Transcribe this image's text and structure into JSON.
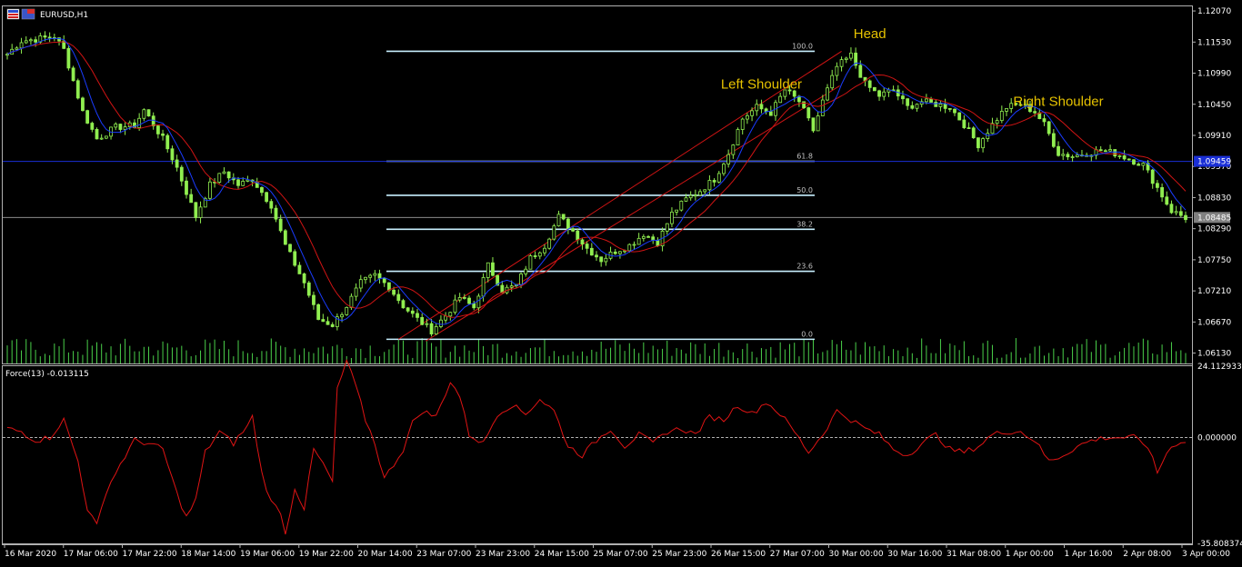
{
  "window": {
    "symbol_label": "EURUSD,H1",
    "flag_icon": "eurusd-flag-icon"
  },
  "indicator": {
    "title": "Force(13) -0.013115"
  },
  "colors": {
    "background": "#000000",
    "bull": "#90ee50",
    "ma_fast": "#1a3cff",
    "ma_slow": "#d01414",
    "fib": "#c8f0ff",
    "hline": "#1a2fd6",
    "current": "#a0a0a0",
    "force": "#e01414",
    "annotation": "#e6c200",
    "volume": "#4ad04a"
  },
  "chart_data": [
    {
      "type": "candlestick",
      "title": "EURUSD,H1",
      "x_tick_labels": [
        "16 Mar 2020",
        "17 Mar 06:00",
        "17 Mar 22:00",
        "18 Mar 14:00",
        "19 Mar 06:00",
        "19 Mar 22:00",
        "20 Mar 14:00",
        "23 Mar 07:00",
        "23 Mar 23:00",
        "24 Mar 15:00",
        "25 Mar 07:00",
        "25 Mar 23:00",
        "26 Mar 15:00",
        "27 Mar 07:00",
        "30 Mar 00:00",
        "30 Mar 16:00",
        "31 Mar 08:00",
        "1 Apr 00:00",
        "1 Apr 16:00",
        "2 Apr 08:00",
        "3 Apr 00:00"
      ],
      "y_tick_labels": [
        "1.12070",
        "1.11530",
        "1.10990",
        "1.10450",
        "1.09910",
        "1.09370",
        "1.08830",
        "1.08290",
        "1.07750",
        "1.07210",
        "1.06670",
        "1.06130"
      ],
      "ylim": [
        1.0595,
        1.1215
      ],
      "price_path": [
        [
          0,
          1.1132
        ],
        [
          3,
          1.1155
        ],
        [
          6,
          1.1158
        ],
        [
          10,
          1.1163
        ],
        [
          12,
          1.114
        ],
        [
          16,
          1.1032
        ],
        [
          19,
          1.0985
        ],
        [
          23,
          1.1005
        ],
        [
          27,
          1.1008
        ],
        [
          29,
          1.1035
        ],
        [
          33,
          1.0985
        ],
        [
          36,
          1.0935
        ],
        [
          40,
          1.085
        ],
        [
          43,
          1.0905
        ],
        [
          46,
          1.0928
        ],
        [
          49,
          1.0905
        ],
        [
          52,
          1.0915
        ],
        [
          56,
          1.087
        ],
        [
          59,
          1.08
        ],
        [
          63,
          1.0735
        ],
        [
          66,
          1.0672
        ],
        [
          69,
          1.0662
        ],
        [
          72,
          1.0695
        ],
        [
          75,
          1.0735
        ],
        [
          78,
          1.0748
        ],
        [
          81,
          1.0728
        ],
        [
          84,
          1.0695
        ],
        [
          87,
          1.0672
        ],
        [
          90,
          1.0652
        ],
        [
          93,
          1.0678
        ],
        [
          96,
          1.071
        ],
        [
          99,
          1.0692
        ],
        [
          102,
          1.0765
        ],
        [
          105,
          1.0722
        ],
        [
          108,
          1.073
        ],
        [
          111,
          1.0778
        ],
        [
          114,
          1.08
        ],
        [
          117,
          1.085
        ],
        [
          120,
          1.0825
        ],
        [
          123,
          1.0795
        ],
        [
          126,
          1.0775
        ],
        [
          129,
          1.079
        ],
        [
          132,
          1.08
        ],
        [
          135,
          1.082
        ],
        [
          138,
          1.0805
        ],
        [
          141,
          1.0855
        ],
        [
          144,
          1.088
        ],
        [
          147,
          1.0895
        ],
        [
          150,
          1.0915
        ],
        [
          153,
          1.096
        ],
        [
          156,
          1.102
        ],
        [
          159,
          1.104
        ],
        [
          162,
          1.103
        ],
        [
          165,
          1.107
        ],
        [
          168,
          1.105
        ],
        [
          171,
          1.1
        ],
        [
          173,
          1.105
        ],
        [
          176,
          1.111
        ],
        [
          179,
          1.113
        ],
        [
          182,
          1.108
        ],
        [
          185,
          1.106
        ],
        [
          188,
          1.107
        ],
        [
          191,
          1.104
        ],
        [
          194,
          1.105
        ],
        [
          197,
          1.1045
        ],
        [
          200,
          1.104
        ],
        [
          203,
          1.101
        ],
        [
          206,
          1.0975
        ],
        [
          209,
          1.101
        ],
        [
          212,
          1.104
        ],
        [
          215,
          1.1045
        ],
        [
          218,
          1.1032
        ],
        [
          220,
          1.101
        ],
        [
          223,
          1.096
        ],
        [
          226,
          1.0955
        ],
        [
          229,
          1.096
        ],
        [
          232,
          1.0965
        ],
        [
          235,
          1.096
        ],
        [
          238,
          1.095
        ],
        [
          241,
          1.094
        ],
        [
          244,
          1.09
        ],
        [
          247,
          1.086
        ],
        [
          250,
          1.0848
        ]
      ],
      "bar_count": 251,
      "current_price": "1.08485",
      "hline_price": "1.09459",
      "fibonacci": {
        "levels": [
          {
            "label": "100.0",
            "price": 1.1137
          },
          {
            "label": "61.8",
            "price": 1.0946
          },
          {
            "label": "50.0",
            "price": 1.0887
          },
          {
            "label": "38.2",
            "price": 1.0828
          },
          {
            "label": "23.6",
            "price": 1.0755
          },
          {
            "label": "0.0",
            "price": 1.0637
          }
        ]
      },
      "annotations": [
        {
          "text": "Head",
          "price": 1.116,
          "bar": 183
        },
        {
          "text": "Left Shoulder",
          "price": 1.1072,
          "bar": 160
        },
        {
          "text": "Right Shoulder",
          "price": 1.1042,
          "bar": 223
        }
      ],
      "trend_channel": {
        "from": {
          "bar": 83,
          "price": 1.0637
        },
        "to": {
          "bar": 177,
          "price": 1.1137
        }
      }
    },
    {
      "type": "line",
      "title": "Force(13) -0.013115",
      "y_tick_labels": [
        "24.112933",
        "0.000000",
        "-35.808374"
      ],
      "ylim": [
        -35.808374,
        24.112933
      ],
      "values_path": [
        [
          0,
          3
        ],
        [
          3,
          2
        ],
        [
          6,
          -1
        ],
        [
          9,
          0
        ],
        [
          12,
          6
        ],
        [
          15,
          -8
        ],
        [
          17,
          -24
        ],
        [
          19,
          -30
        ],
        [
          21,
          -18
        ],
        [
          24,
          -9
        ],
        [
          27,
          -1
        ],
        [
          30,
          -2
        ],
        [
          33,
          -4
        ],
        [
          36,
          -19
        ],
        [
          38,
          -27
        ],
        [
          40,
          -21
        ],
        [
          42,
          -5
        ],
        [
          45,
          2
        ],
        [
          48,
          -2
        ],
        [
          51,
          4
        ],
        [
          52,
          7
        ],
        [
          54,
          -12
        ],
        [
          56,
          -22
        ],
        [
          58,
          -25
        ],
        [
          59,
          -33
        ],
        [
          61,
          -17
        ],
        [
          63,
          -24
        ],
        [
          65,
          -4
        ],
        [
          67,
          -9
        ],
        [
          69,
          -15
        ],
        [
          70,
          16
        ],
        [
          72,
          26
        ],
        [
          74,
          17
        ],
        [
          76,
          6
        ],
        [
          78,
          -2
        ],
        [
          80,
          -14
        ],
        [
          82,
          -9
        ],
        [
          84,
          -4
        ],
        [
          86,
          5
        ],
        [
          88,
          9
        ],
        [
          91,
          7
        ],
        [
          94,
          19
        ],
        [
          96,
          14
        ],
        [
          98,
          1
        ],
        [
          101,
          -2
        ],
        [
          104,
          8
        ],
        [
          107,
          11
        ],
        [
          110,
          8
        ],
        [
          113,
          13
        ],
        [
          116,
          9
        ],
        [
          119,
          -3
        ],
        [
          122,
          -6
        ],
        [
          125,
          -1
        ],
        [
          128,
          3
        ],
        [
          131,
          -3
        ],
        [
          134,
          1
        ],
        [
          137,
          -2
        ],
        [
          140,
          2
        ],
        [
          143,
          3
        ],
        [
          146,
          1
        ],
        [
          149,
          7
        ],
        [
          152,
          6
        ],
        [
          155,
          11
        ],
        [
          158,
          8
        ],
        [
          161,
          12
        ],
        [
          164,
          8
        ],
        [
          167,
          2
        ],
        [
          170,
          -5
        ],
        [
          173,
          1
        ],
        [
          176,
          9
        ],
        [
          179,
          6
        ],
        [
          182,
          3
        ],
        [
          185,
          1
        ],
        [
          188,
          -4
        ],
        [
          191,
          -6
        ],
        [
          194,
          -2
        ],
        [
          197,
          1
        ],
        [
          200,
          -4
        ],
        [
          203,
          -5
        ],
        [
          206,
          -3
        ],
        [
          209,
          1
        ],
        [
          212,
          2
        ],
        [
          215,
          2
        ],
        [
          218,
          -1
        ],
        [
          221,
          -8
        ],
        [
          224,
          -6
        ],
        [
          227,
          -3
        ],
        [
          230,
          -1
        ],
        [
          233,
          0
        ],
        [
          236,
          0
        ],
        [
          239,
          0
        ],
        [
          242,
          -3
        ],
        [
          244,
          -12
        ],
        [
          246,
          -5
        ],
        [
          248,
          -2
        ],
        [
          250,
          -1
        ]
      ]
    }
  ]
}
